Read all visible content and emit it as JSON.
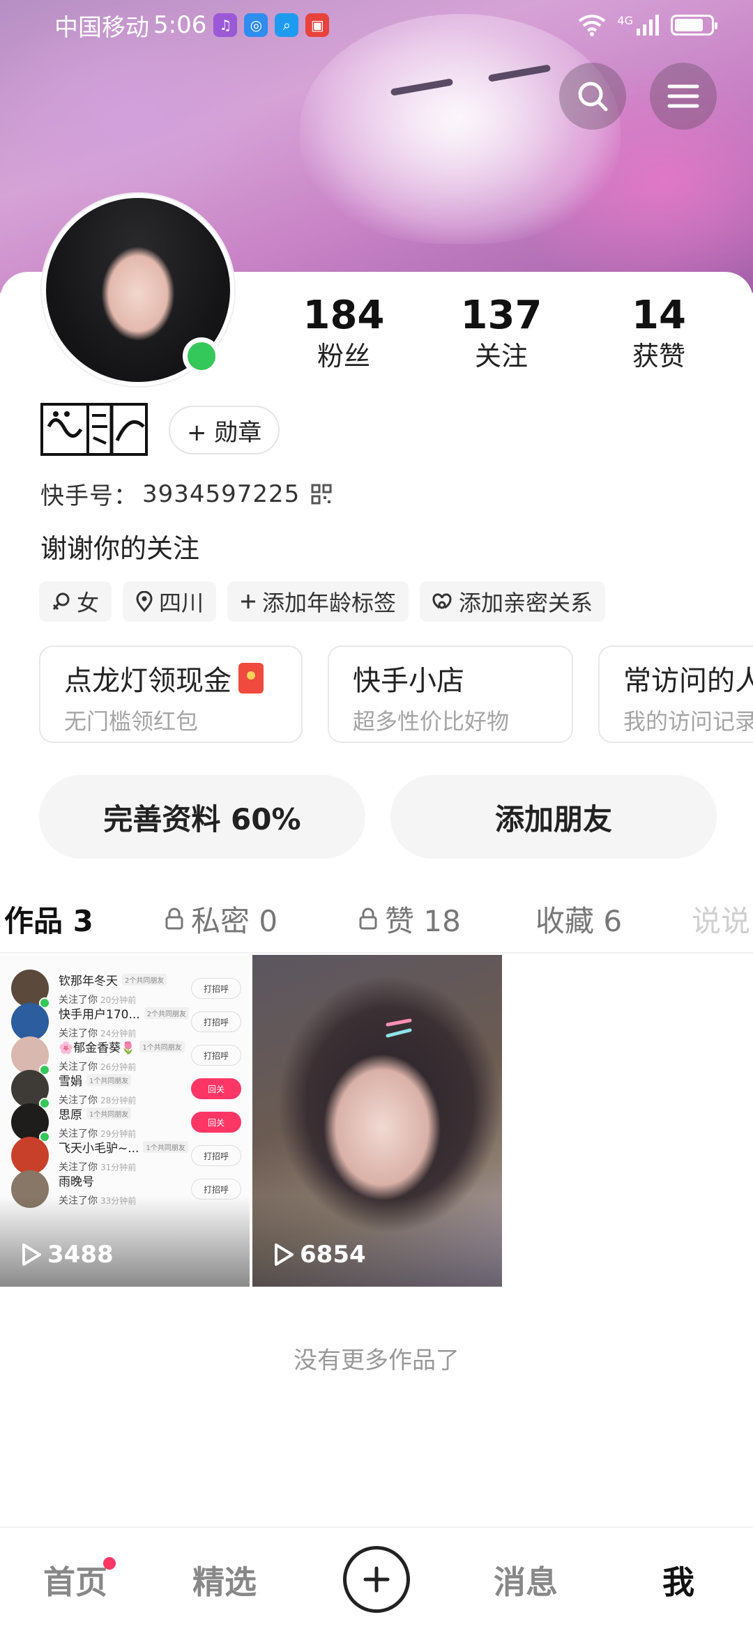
{
  "status_bar": {
    "carrier": "中国移动",
    "time": "5:06",
    "network": "4G",
    "app_icons": [
      {
        "name": "music-app-icon",
        "glyph": "♫",
        "color": "#9b59d6"
      },
      {
        "name": "browser-app-icon",
        "glyph": "◎",
        "color": "#2f8cf0"
      },
      {
        "name": "search-app-icon",
        "glyph": "⌕",
        "color": "#1e9bf0"
      },
      {
        "name": "huawei-store-icon",
        "glyph": "▣",
        "color": "#e8423c"
      }
    ]
  },
  "header": {
    "search_icon": "search-icon",
    "menu_icon": "menu-icon"
  },
  "profile": {
    "stats": [
      {
        "value": "184",
        "label": "粉丝"
      },
      {
        "value": "137",
        "label": "关注"
      },
      {
        "value": "14",
        "label": "获赞"
      }
    ],
    "medal_label": "+ 勋章",
    "account_label": "快手号：",
    "account_id": "3934597225",
    "bio": "谢谢你的关注",
    "tags": [
      {
        "icon": "gender-icon",
        "label": "女"
      },
      {
        "icon": "location-icon",
        "label": "四川"
      },
      {
        "icon": "plus-icon",
        "label": "添加年龄标签"
      },
      {
        "icon": "relationship-icon",
        "label": "添加亲密关系"
      }
    ]
  },
  "promos": [
    {
      "title": "点龙灯领现金",
      "subtitle": "无门槛领红包"
    },
    {
      "title": "快手小店",
      "subtitle": "超多性价比好物"
    },
    {
      "title": "常访问的人",
      "subtitle": "我的访问记录"
    }
  ],
  "actions": {
    "complete_profile": "完善资料 60%",
    "add_friends": "添加朋友"
  },
  "tabs": [
    {
      "label": "作品 3",
      "locked": false,
      "active": true
    },
    {
      "label": "私密 0",
      "locked": true,
      "active": false
    },
    {
      "label": "赞 18",
      "locked": true,
      "active": false
    },
    {
      "label": "收藏 6",
      "locked": false,
      "active": false
    },
    {
      "label": "说说",
      "locked": false,
      "active": false
    }
  ],
  "works": [
    {
      "play_count": "3488",
      "followers_list": [
        {
          "name": "钦那年冬天",
          "mutual": "2个共同朋友",
          "sub": "关注了你",
          "time": "20分钟前",
          "button": "打招呼",
          "red": false,
          "avatar": "#5b4a3c",
          "online": true
        },
        {
          "name": "快手用户170...",
          "mutual": "2个共同朋友",
          "sub": "关注了你",
          "time": "24分钟前",
          "button": "打招呼",
          "red": false,
          "avatar": "#2c5d9e",
          "online": false
        },
        {
          "name": "🌸郁金香葵🌷",
          "mutual": "1个共同朋友",
          "sub": "关注了你",
          "time": "26分钟前",
          "button": "打招呼",
          "red": false,
          "avatar": "#d9b8b0",
          "online": true
        },
        {
          "name": "雪娟",
          "mutual": "1个共同朋友",
          "sub": "关注了你",
          "time": "28分钟前",
          "button": "回关",
          "red": true,
          "avatar": "#3e3a36",
          "online": true
        },
        {
          "name": "思原",
          "mutual": "1个共同朋友",
          "sub": "关注了你",
          "time": "29分钟前",
          "button": "回关",
          "red": true,
          "avatar": "#1f1c1c",
          "online": true
        },
        {
          "name": "飞天小毛驴~...",
          "mutual": "1个共同朋友",
          "sub": "关注了你",
          "time": "31分钟前",
          "button": "打招呼",
          "red": false,
          "avatar": "#c9402a",
          "online": false
        },
        {
          "name": "雨晚号",
          "mutual": "",
          "sub": "关注了你",
          "time": "33分钟前",
          "button": "打招呼",
          "red": false,
          "avatar": "#887766",
          "online": false
        }
      ]
    },
    {
      "play_count": "6854"
    }
  ],
  "footer_note": "没有更多作品了",
  "bottom_nav": [
    {
      "label": "首页",
      "active": false,
      "badge": true
    },
    {
      "label": "精选",
      "active": false,
      "badge": false
    },
    {
      "label": "消息",
      "active": false,
      "badge": false
    },
    {
      "label": "我",
      "active": true,
      "badge": false
    }
  ],
  "colors": {
    "accent_red": "#fe3666",
    "online_green": "#34c759",
    "tag_bg": "#f5f5f5"
  }
}
